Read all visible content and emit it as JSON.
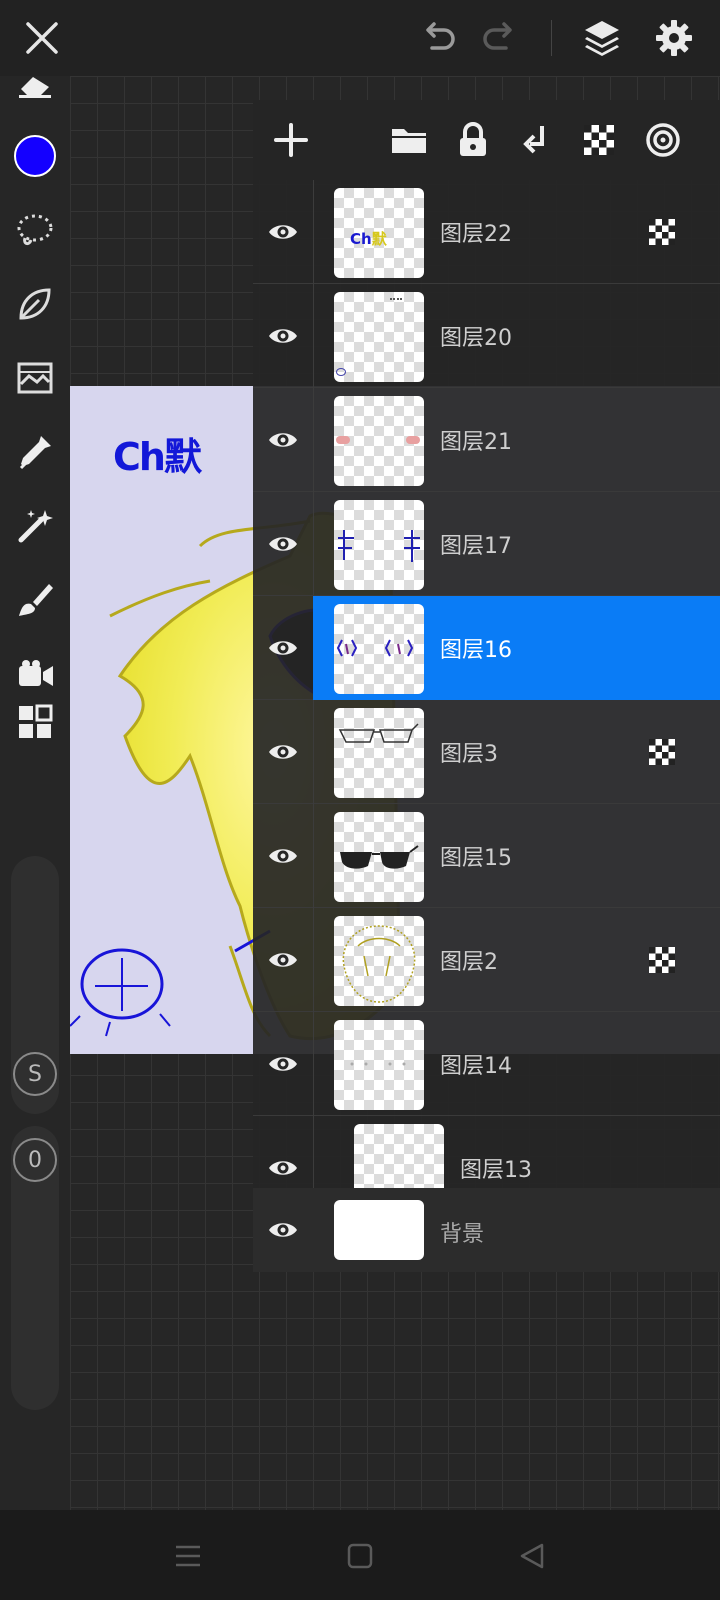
{
  "toolbar": {
    "close_icon": "close-icon",
    "undo_icon": "undo-icon",
    "redo_icon": "redo-icon",
    "layers_icon": "layers-icon",
    "settings_icon": "gear-icon"
  },
  "left_tools": {
    "current_color": "#1400ff",
    "size_indicator": "S",
    "opacity_value": "0"
  },
  "artwork": {
    "header_text": "Ch默"
  },
  "layer_panel": {
    "tools": [
      "add-layer-icon",
      "folder-icon",
      "lock-icon",
      "merge-down-icon",
      "alpha-lock-icon",
      "blend-mode-icon"
    ],
    "layers": [
      {
        "name": "图层22",
        "alpha": true,
        "selected": false
      },
      {
        "name": "图层20",
        "alpha": false,
        "selected": false
      },
      {
        "name": "图层21",
        "alpha": false,
        "selected": false
      },
      {
        "name": "图层17",
        "alpha": false,
        "selected": false
      },
      {
        "name": "图层16",
        "alpha": false,
        "selected": true
      },
      {
        "name": "图层3",
        "alpha": true,
        "selected": false
      },
      {
        "name": "图层15",
        "alpha": false,
        "selected": false
      },
      {
        "name": "图层2",
        "alpha": true,
        "selected": false
      },
      {
        "name": "图层14",
        "alpha": false,
        "selected": false
      },
      {
        "name": "图层13",
        "alpha": false,
        "selected": false
      }
    ],
    "background_layer": {
      "name": "背景"
    }
  },
  "colors": {
    "accent": "#0a7cf6",
    "panel_bg": "#262626"
  }
}
